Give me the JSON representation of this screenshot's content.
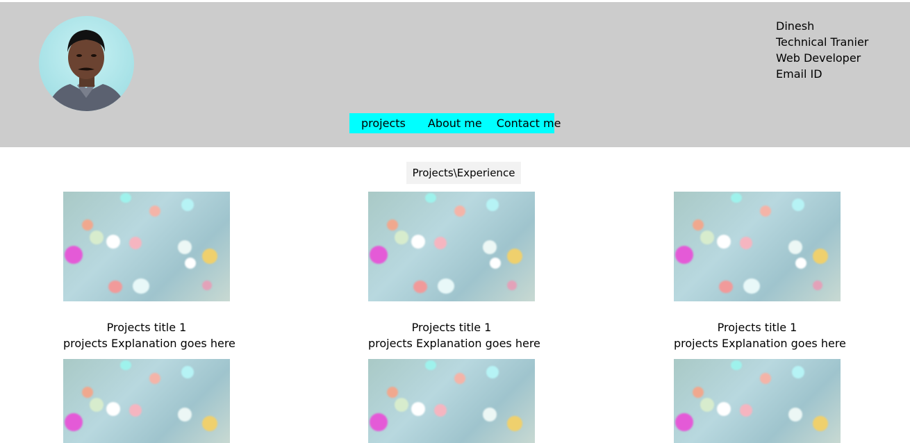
{
  "profile": {
    "name": "Dinesh",
    "role1": "Technical Tranier",
    "role2": "Web Developer",
    "email": "Email ID"
  },
  "nav": {
    "items": [
      "projects",
      "About me",
      "Contact me"
    ],
    "bg_color": "#00ffff"
  },
  "section": {
    "title": "Projects\\Experience"
  },
  "projects": [
    {
      "title": "Projects title 1",
      "desc": "projects Explanation goes here"
    },
    {
      "title": "Projects title 1",
      "desc": "projects Explanation goes here"
    },
    {
      "title": "Projects title 1",
      "desc": "projects Explanation goes here"
    }
  ],
  "colors": {
    "header_bg": "#cccccc",
    "title_bg": "#f2f2f2"
  }
}
